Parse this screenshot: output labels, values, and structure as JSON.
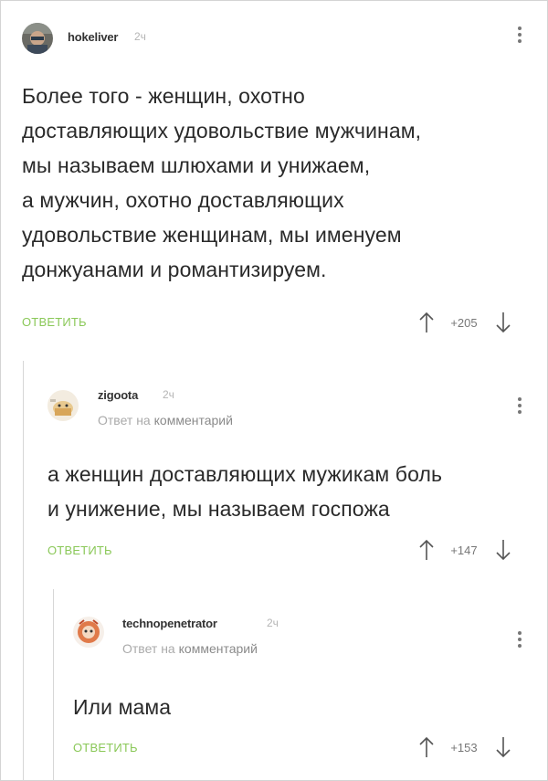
{
  "comments": [
    {
      "username": "hokeliver",
      "time": "2ч",
      "reply_prefix": "",
      "reply_target": "",
      "lines": [
        "Более того - женщин, охотно",
        "доставляющих удовольствие мужчинам,",
        "мы называем шлюхами и унижаем,",
        "а мужчин, охотно доставляющих",
        "удовольствие женщинам, мы именуем",
        "донжуанами и романтизируем."
      ],
      "reply_label": "ОТВЕТИТЬ",
      "score": "+205"
    },
    {
      "username": "zigoota",
      "time": "2ч",
      "reply_prefix": "Ответ на",
      "reply_target": "комментарий",
      "lines": [
        "а женщин доставляющих мужикам боль",
        "и унижение, мы называем госпожа"
      ],
      "reply_label": "ОТВЕТИТЬ",
      "score": "+147"
    },
    {
      "username": "technopenetrator",
      "time": "2ч",
      "reply_prefix": "Ответ на",
      "reply_target": "комментарий",
      "lines": [
        "Или мама"
      ],
      "reply_label": "ОТВЕТИТЬ",
      "score": "+153"
    }
  ],
  "colors": {
    "reply_green": "#8ac858",
    "thread_line": "#d6d6d6"
  },
  "icons": [
    "avatar",
    "more-vertical-icon",
    "arrow-up-icon",
    "arrow-down-icon"
  ]
}
